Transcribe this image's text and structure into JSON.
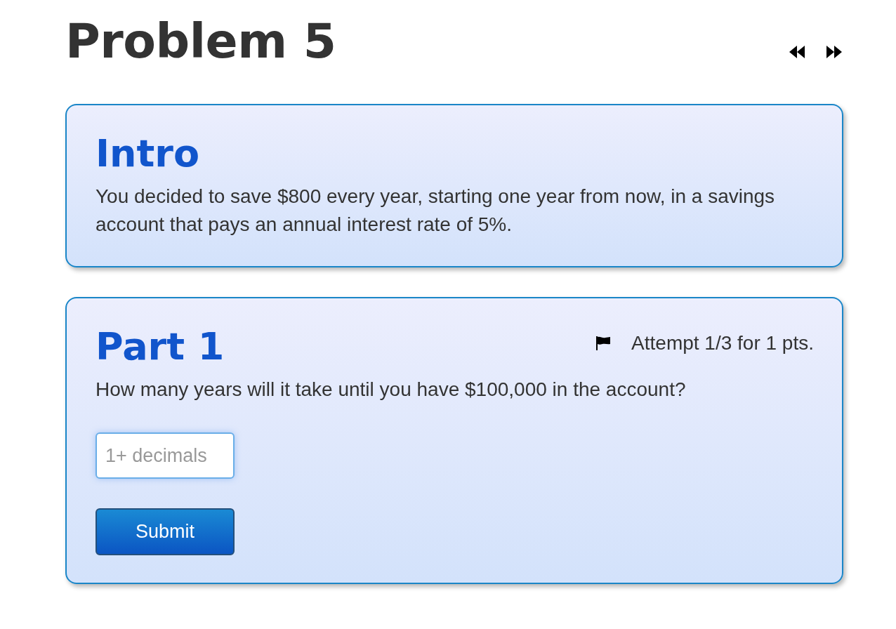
{
  "header": {
    "title": "Problem 5"
  },
  "sections": [
    {
      "heading": "Intro",
      "text": "You decided to save $800 every year, starting one year from now, in a savings account that pays an annual interest rate of 5%."
    },
    {
      "heading": "Part 1",
      "attempt": "Attempt 1/3 for 1 pts.",
      "text": "How many years will it take until you have $100,000 in the account?",
      "answer": {
        "placeholder": "1+ decimals"
      },
      "button": "Submit"
    }
  ]
}
